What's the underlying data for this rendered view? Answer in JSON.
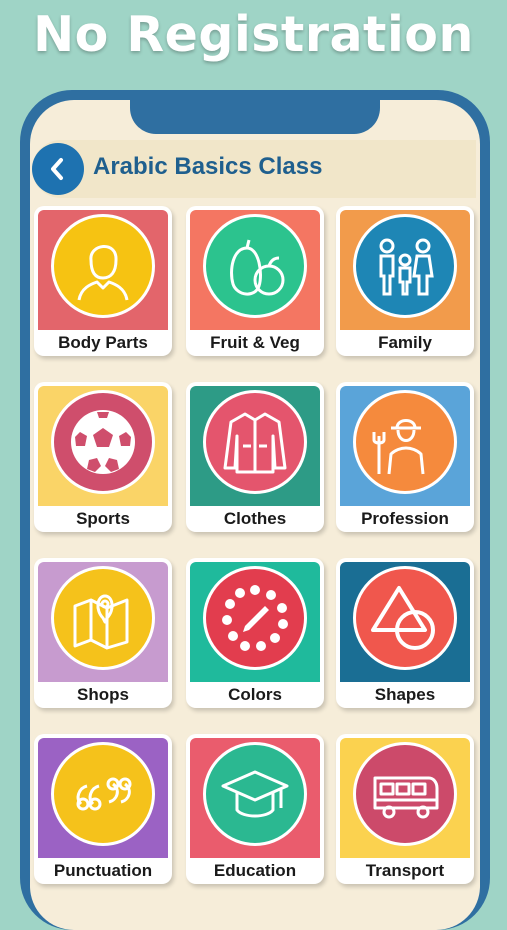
{
  "banner": {
    "headline": "No Registration"
  },
  "header": {
    "title": "Arabic Basics Class"
  },
  "categories": [
    {
      "label": "Body Parts",
      "icon": "person-icon",
      "bg": "#e3656b",
      "circle": "#f6c312"
    },
    {
      "label": "Fruit & Veg",
      "icon": "fruit-icon",
      "bg": "#f47662",
      "circle": "#2cc38e"
    },
    {
      "label": "Family",
      "icon": "family-icon",
      "bg": "#f29b4b",
      "circle": "#1e86b5"
    },
    {
      "label": "Sports",
      "icon": "soccer-ball-icon",
      "bg": "#fad467",
      "circle": "#cf4e6c"
    },
    {
      "label": "Clothes",
      "icon": "jacket-icon",
      "bg": "#2d9b86",
      "circle": "#e4556d"
    },
    {
      "label": "Profession",
      "icon": "farmer-icon",
      "bg": "#5aa4d9",
      "circle": "#f58a3d"
    },
    {
      "label": "Shops",
      "icon": "map-pin-icon",
      "bg": "#c79bcf",
      "circle": "#f5c21b"
    },
    {
      "label": "Colors",
      "icon": "palette-icon",
      "bg": "#1fba9c",
      "circle": "#e23d4e"
    },
    {
      "label": "Shapes",
      "icon": "shapes-icon",
      "bg": "#1a6e94",
      "circle": "#f0574d"
    },
    {
      "label": "Punctuation",
      "icon": "quote-marks-icon",
      "bg": "#9b62c4",
      "circle": "#f5c21b"
    },
    {
      "label": "Education",
      "icon": "graduation-cap-icon",
      "bg": "#ea5c6d",
      "circle": "#2bb891"
    },
    {
      "label": "Transport",
      "icon": "bus-icon",
      "bg": "#fbd24f",
      "circle": "#cc4a6a"
    }
  ]
}
